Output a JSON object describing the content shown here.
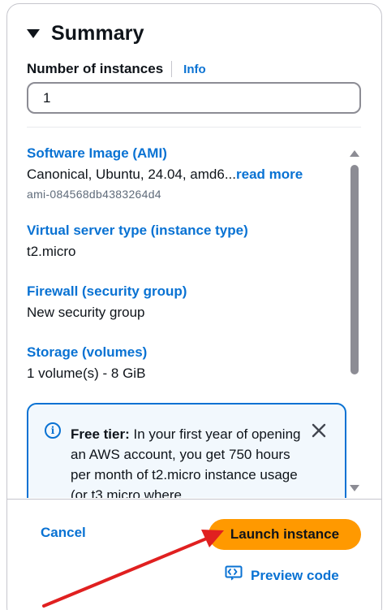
{
  "summary": {
    "title": "Summary",
    "instances_label": "Number of instances",
    "info_link": "Info",
    "instances_value": "1"
  },
  "sections": {
    "ami": {
      "title": "Software Image (AMI)",
      "value": "Canonical, Ubuntu, 24.04, amd6...",
      "read_more": "read more",
      "id": "ami-084568db4383264d4"
    },
    "instance_type": {
      "title": "Virtual server type (instance type)",
      "value": "t2.micro"
    },
    "firewall": {
      "title": "Firewall (security group)",
      "value": "New security group"
    },
    "storage": {
      "title": "Storage (volumes)",
      "value": "1 volume(s) - 8 GiB"
    }
  },
  "free_tier": {
    "label": "Free tier:",
    "text": "In your first year of opening an AWS account, you get 750 hours per month of t2.micro instance usage (or t3.micro where"
  },
  "actions": {
    "cancel": "Cancel",
    "launch": "Launch instance",
    "preview": "Preview code"
  },
  "colors": {
    "link": "#0972d3",
    "primary_button": "#ff9900",
    "annotation_arrow": "#e02020"
  }
}
